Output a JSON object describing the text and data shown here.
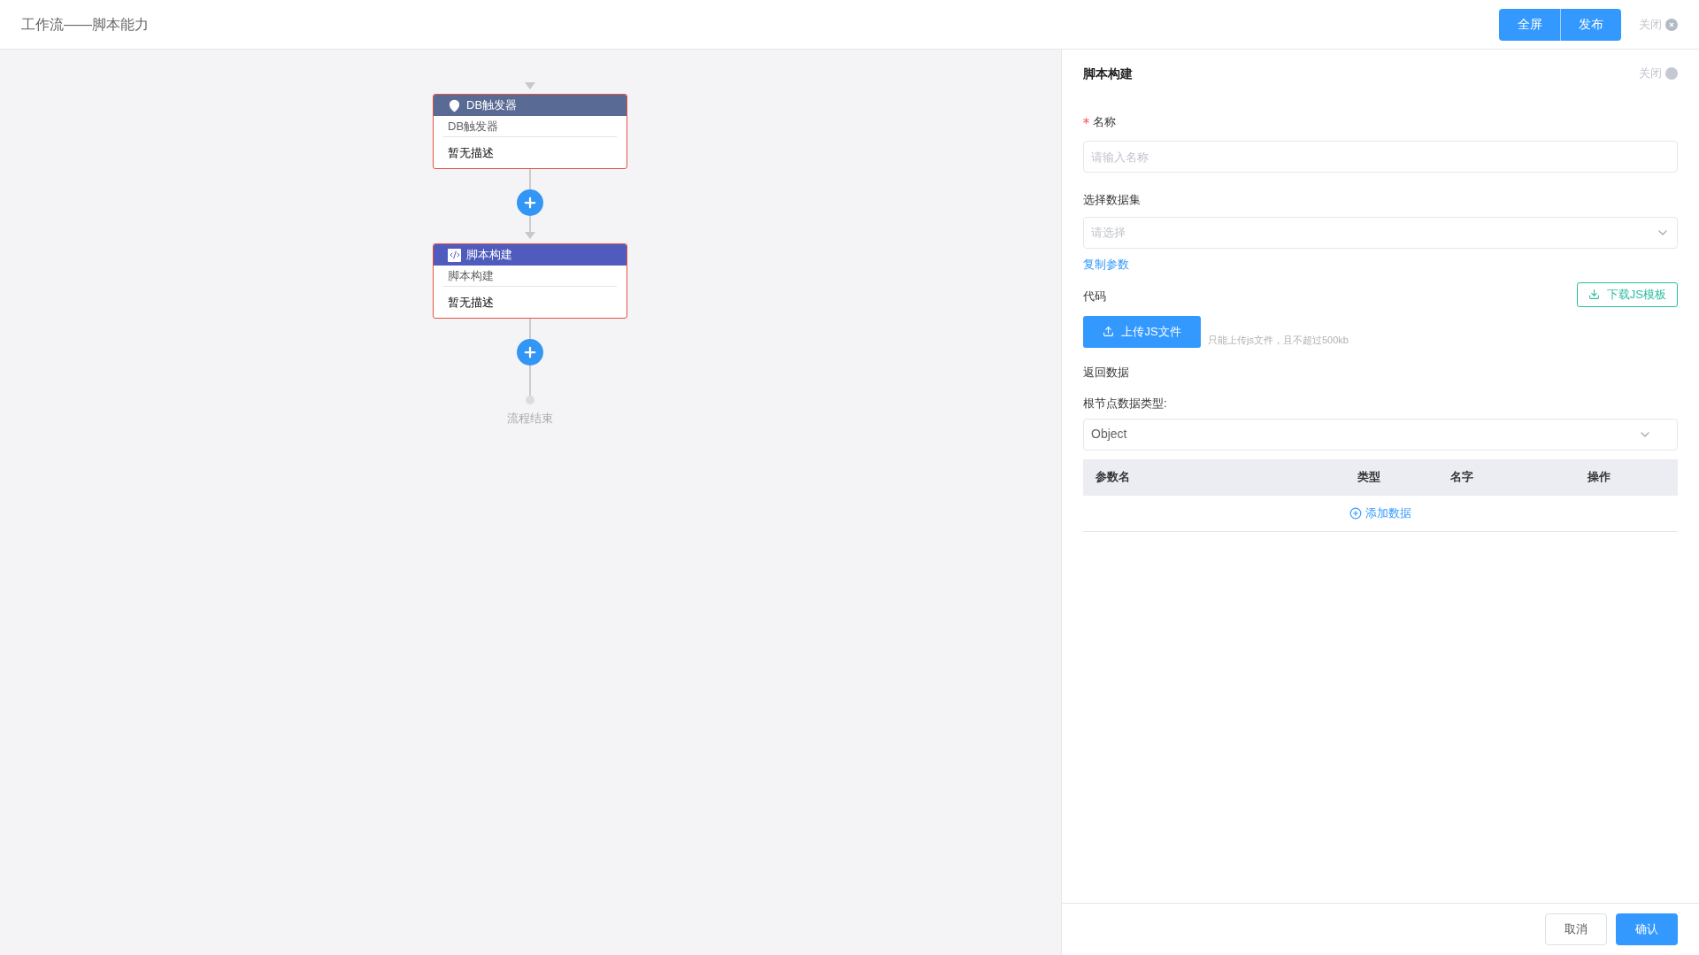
{
  "header": {
    "title": "工作流——脚本能力",
    "buttons": [
      "全屏",
      "发布"
    ],
    "close": "关闭"
  },
  "flow": {
    "nodes": [
      {
        "kind": "trigger",
        "title": "DB触发器",
        "name": "DB触发器",
        "description": "暂无描述"
      },
      {
        "kind": "script",
        "title": "脚本构建",
        "name": "脚本构建",
        "description": "暂无描述"
      }
    ],
    "end_label": "流程结束"
  },
  "panel": {
    "title": "脚本构建",
    "close": "关闭",
    "name_field": {
      "label": "名称",
      "required": true,
      "placeholder": "请输入名称"
    },
    "dataset_field": {
      "label": "选择数据集",
      "placeholder": "请选择"
    },
    "copy_link": "复制参数",
    "code": {
      "label": "代码",
      "download_button": "下载JS模板",
      "upload_button": "上传JS文件",
      "hint": "只能上传js文件，且不超过500kb"
    },
    "return_label": "返回数据",
    "root_type": {
      "label": "根节点数据类型:",
      "value": "Object"
    },
    "table": {
      "columns": [
        "参数名",
        "类型",
        "名字",
        "操作"
      ],
      "add_link": "添加数据"
    },
    "footer": {
      "cancel": "取消",
      "confirm": "确认"
    }
  }
}
